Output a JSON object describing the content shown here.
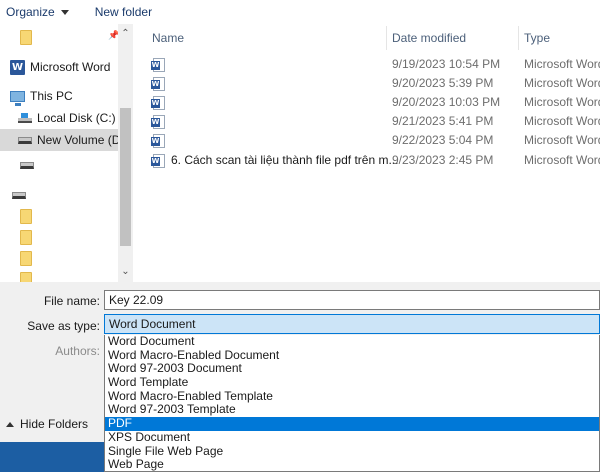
{
  "toolbar": {
    "organize_label": "Organize",
    "new_folder_label": "New folder"
  },
  "nav": {
    "items": [
      {
        "label": "",
        "icon": "folder-icon"
      },
      {
        "label": "Microsoft Word",
        "icon": "word-icon"
      },
      {
        "label": "This PC",
        "icon": "computer-icon"
      },
      {
        "label": "Local Disk (C:)",
        "icon": "windows-drive-icon"
      },
      {
        "label": "New Volume (D:)",
        "icon": "drive-icon",
        "selected": true
      },
      {
        "label": "",
        "icon": "drive-icon"
      },
      {
        "label": "",
        "icon": "drive-icon"
      },
      {
        "label": "",
        "icon": "folder-icon"
      },
      {
        "label": "",
        "icon": "folder-icon"
      },
      {
        "label": "",
        "icon": "folder-icon"
      },
      {
        "label": "",
        "icon": "folder-icon"
      }
    ]
  },
  "file_list": {
    "columns": {
      "name": "Name",
      "date": "Date modified",
      "type": "Type"
    },
    "rows": [
      {
        "name": "",
        "date": "9/19/2023 10:54 PM",
        "type": "Microsoft Word"
      },
      {
        "name": "",
        "date": "9/20/2023 5:39 PM",
        "type": "Microsoft Word"
      },
      {
        "name": "",
        "date": "9/20/2023 10:03 PM",
        "type": "Microsoft Word"
      },
      {
        "name": "",
        "date": "9/21/2023 5:41 PM",
        "type": "Microsoft Word"
      },
      {
        "name": "",
        "date": "9/22/2023 5:04 PM",
        "type": "Microsoft Word"
      },
      {
        "name": "6. Cách scan tài liệu thành file pdf trên m...",
        "date": "9/23/2023 2:45 PM",
        "type": "Microsoft Word"
      }
    ]
  },
  "form": {
    "file_name_label": "File name:",
    "file_name_value": "Key 22.09",
    "save_as_type_label": "Save as type:",
    "save_as_type_value": "Word Document",
    "authors_label": "Authors:"
  },
  "save_type_options": [
    {
      "label": "Word Document"
    },
    {
      "label": "Word Macro-Enabled Document"
    },
    {
      "label": "Word 97-2003 Document"
    },
    {
      "label": "Word Template"
    },
    {
      "label": "Word Macro-Enabled Template"
    },
    {
      "label": "Word 97-2003 Template"
    },
    {
      "label": "PDF",
      "highlighted": true
    },
    {
      "label": "XPS Document"
    },
    {
      "label": "Single File Web Page"
    },
    {
      "label": "Web Page"
    }
  ],
  "hide_folders_label": "Hide Folders",
  "colors": {
    "accent": "#0078d7",
    "word_blue": "#2b579a",
    "folder_yellow": "#f7d774"
  }
}
